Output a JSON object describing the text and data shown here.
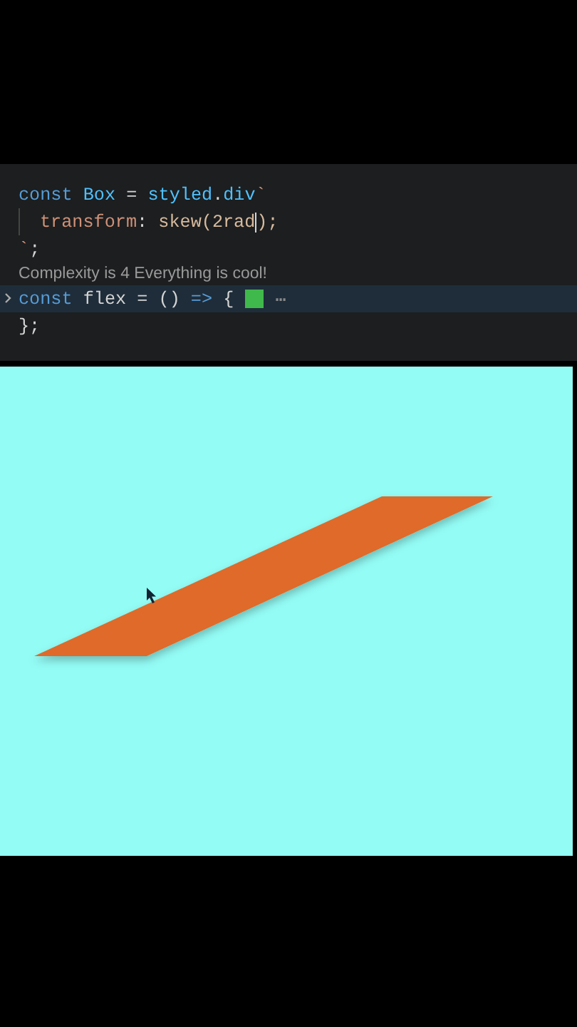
{
  "editor": {
    "lines": [
      {
        "kind": "code",
        "highlighted": false,
        "folded": false,
        "indent": false,
        "tokens": [
          {
            "text": "const",
            "kind": "keyword"
          },
          {
            "text": " Box",
            "kind": "name"
          },
          {
            "text": " =",
            "kind": "plain"
          },
          {
            "text": " styled",
            "kind": "name"
          },
          {
            "text": ".",
            "kind": "plain"
          },
          {
            "text": "div",
            "kind": "name"
          },
          {
            "text": "`",
            "kind": "string"
          }
        ]
      },
      {
        "kind": "code",
        "highlighted": false,
        "folded": false,
        "indent": true,
        "tokens": [
          {
            "text": "transform",
            "kind": "string"
          },
          {
            "text": ":",
            "kind": "plain"
          },
          {
            "text": " skew(2rad",
            "kind": "value"
          },
          {
            "kind": "cursor"
          },
          {
            "text": ");",
            "kind": "value"
          }
        ]
      },
      {
        "kind": "code",
        "highlighted": false,
        "folded": false,
        "indent": false,
        "tokens": [
          {
            "text": "`",
            "kind": "string"
          },
          {
            "text": ";",
            "kind": "plain"
          }
        ]
      },
      {
        "kind": "lens",
        "text": "Complexity is 4 Everything is cool!"
      },
      {
        "kind": "code",
        "highlighted": true,
        "folded": true,
        "indent": false,
        "tokens": [
          {
            "text": "const",
            "kind": "keyword"
          },
          {
            "text": " flex = ()",
            "kind": "plain"
          },
          {
            "text": " =>",
            "kind": "keyword"
          },
          {
            "text": " {",
            "kind": "plain"
          },
          {
            "kind": "swatch",
            "color": "#3fb94b"
          },
          {
            "text": "⋯",
            "kind": "fold"
          }
        ]
      },
      {
        "kind": "code",
        "highlighted": false,
        "folded": false,
        "indent": false,
        "tokens": [
          {
            "text": "};",
            "kind": "plain"
          }
        ]
      }
    ]
  },
  "preview": {
    "box": {
      "color": "#df6a2b"
    }
  }
}
